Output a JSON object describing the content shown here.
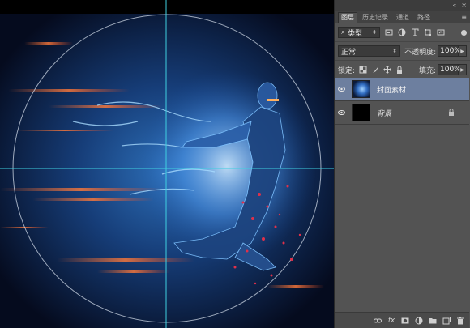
{
  "panel": {
    "collapse_icons": [
      "«",
      "×"
    ],
    "tabs": [
      {
        "label": "图层",
        "active": true
      },
      {
        "label": "历史记录",
        "active": false
      },
      {
        "label": "通道",
        "active": false
      },
      {
        "label": "路径",
        "active": false
      }
    ],
    "tab_menu": "≡",
    "filter": {
      "kind_label": "类型",
      "search_glyph": "⌕"
    },
    "blend": {
      "mode": "正常",
      "opacity_label": "不透明度:",
      "opacity_value": "100%"
    },
    "lock": {
      "label": "锁定:",
      "fill_label": "填充:",
      "fill_value": "100%"
    },
    "layers": [
      {
        "name": "封面素材",
        "visible": true,
        "selected": true,
        "locked": false
      },
      {
        "name": "背景",
        "visible": true,
        "selected": false,
        "locked": true
      }
    ],
    "bottom_icons": [
      "link-icon",
      "fx-icon",
      "mask-icon",
      "adjustment-icon",
      "group-folder-icon",
      "new-layer-icon",
      "trash-icon"
    ],
    "fx_glyph": "fx"
  },
  "canvas": {
    "guide_color": "#3fd0e0",
    "background": "#0a1530"
  }
}
